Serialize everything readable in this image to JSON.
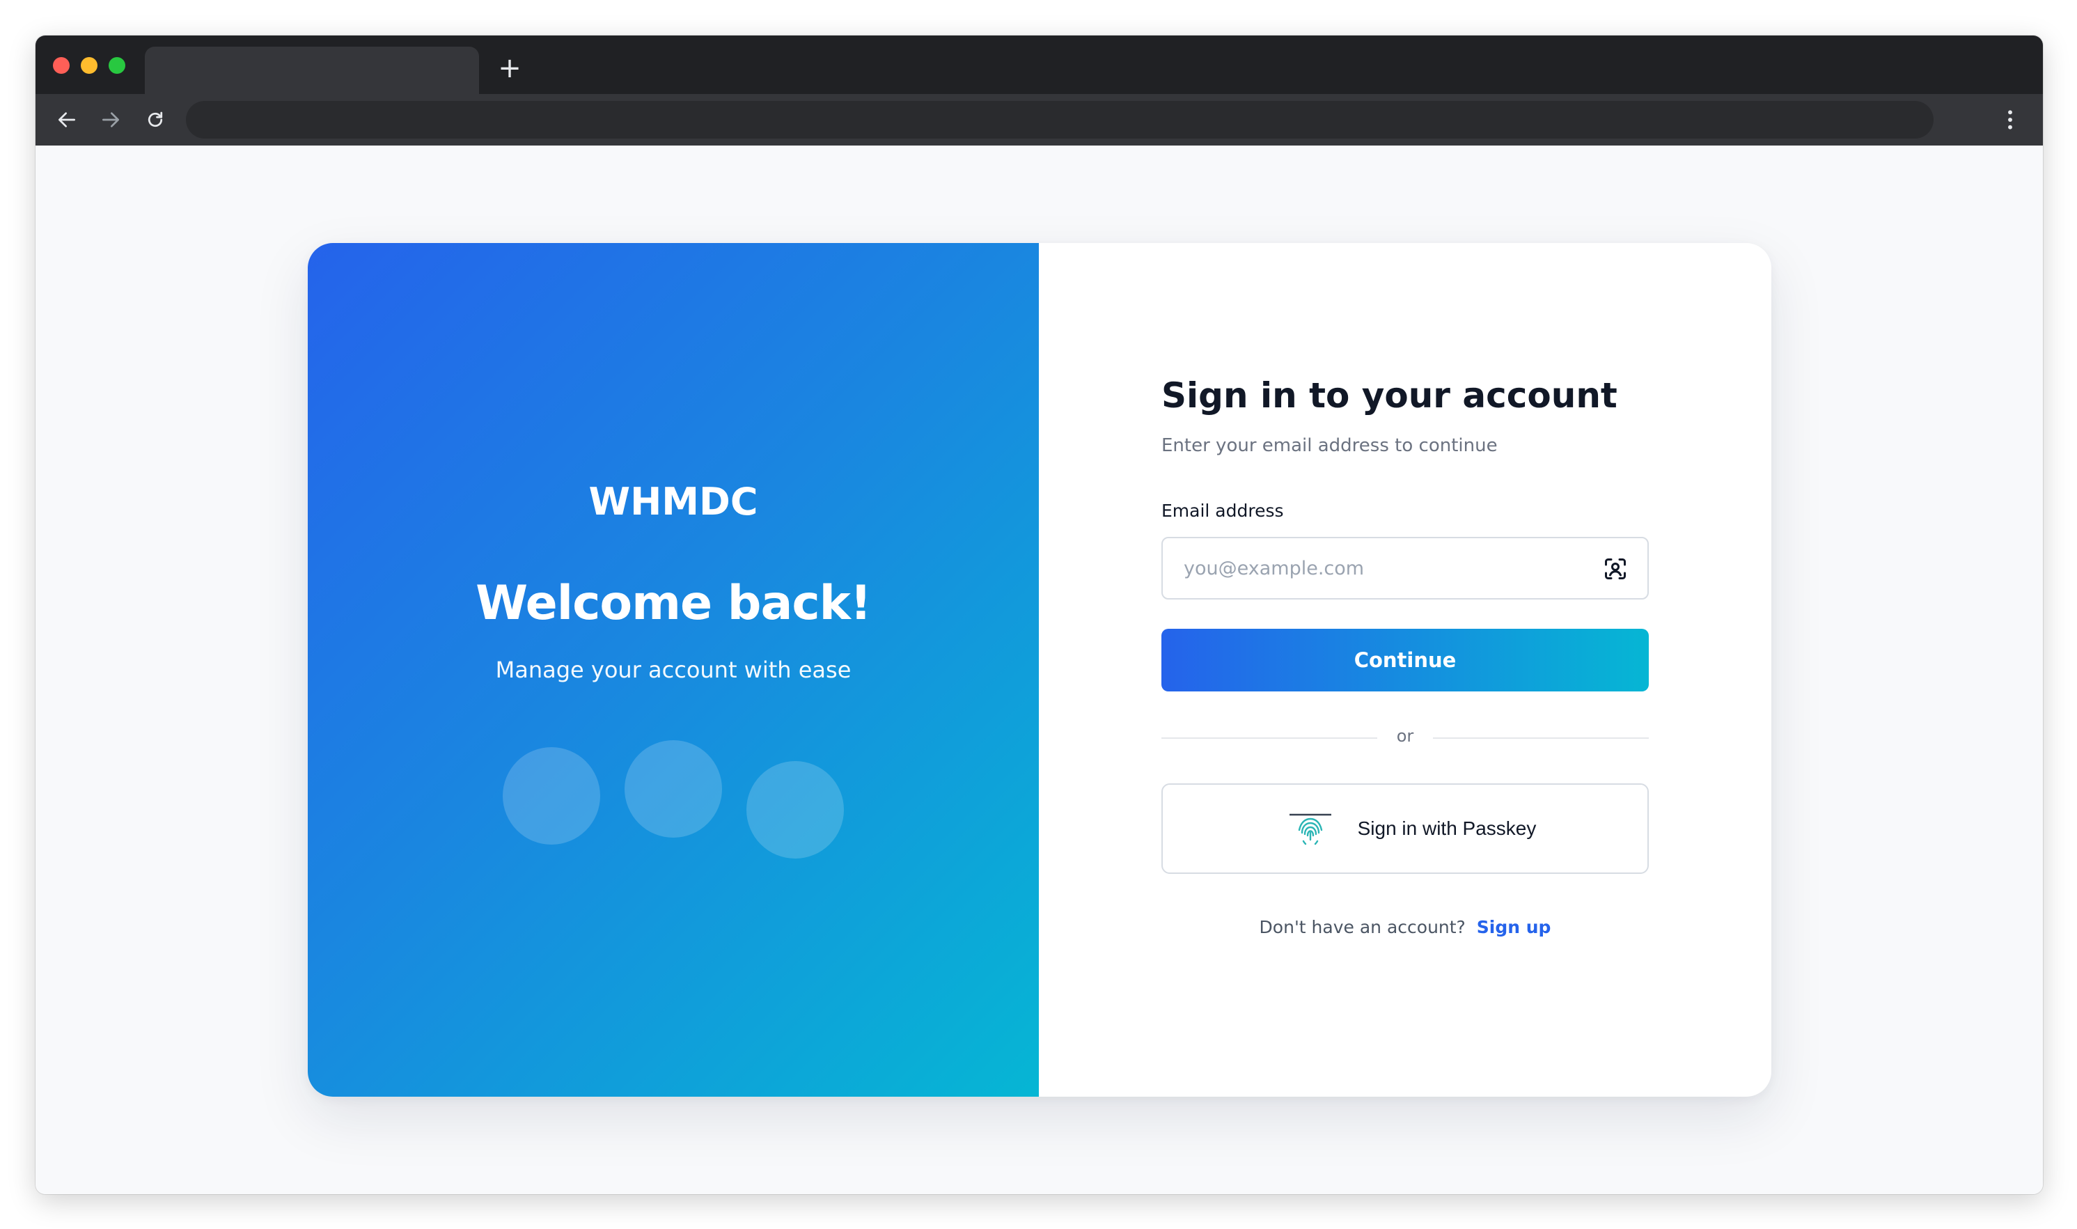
{
  "browser": {
    "tab_title": "",
    "new_tab_symbol": "+",
    "address": ""
  },
  "hero": {
    "brand": "WHMDC",
    "welcome": "Welcome back!",
    "tagline": "Manage your account with ease",
    "gradient_start": "#2563eb",
    "gradient_end": "#06b6d4"
  },
  "form": {
    "title": "Sign in to your account",
    "subtitle": "Enter your email address to continue",
    "email_label": "Email address",
    "email_value": "",
    "email_placeholder": "you@example.com",
    "continue_label": "Continue",
    "divider_text": "or",
    "passkey_label": "Sign in with Passkey",
    "signup_prompt": "Don't have an account?",
    "signup_link": "Sign up",
    "accent_color": "#2563eb"
  },
  "icons": {
    "autofill": "autofill-contact-icon",
    "passkey": "fingerprint-icon",
    "back": "arrow-left-icon",
    "forward": "arrow-right-icon",
    "reload": "reload-icon",
    "menu": "kebab-menu-icon"
  }
}
